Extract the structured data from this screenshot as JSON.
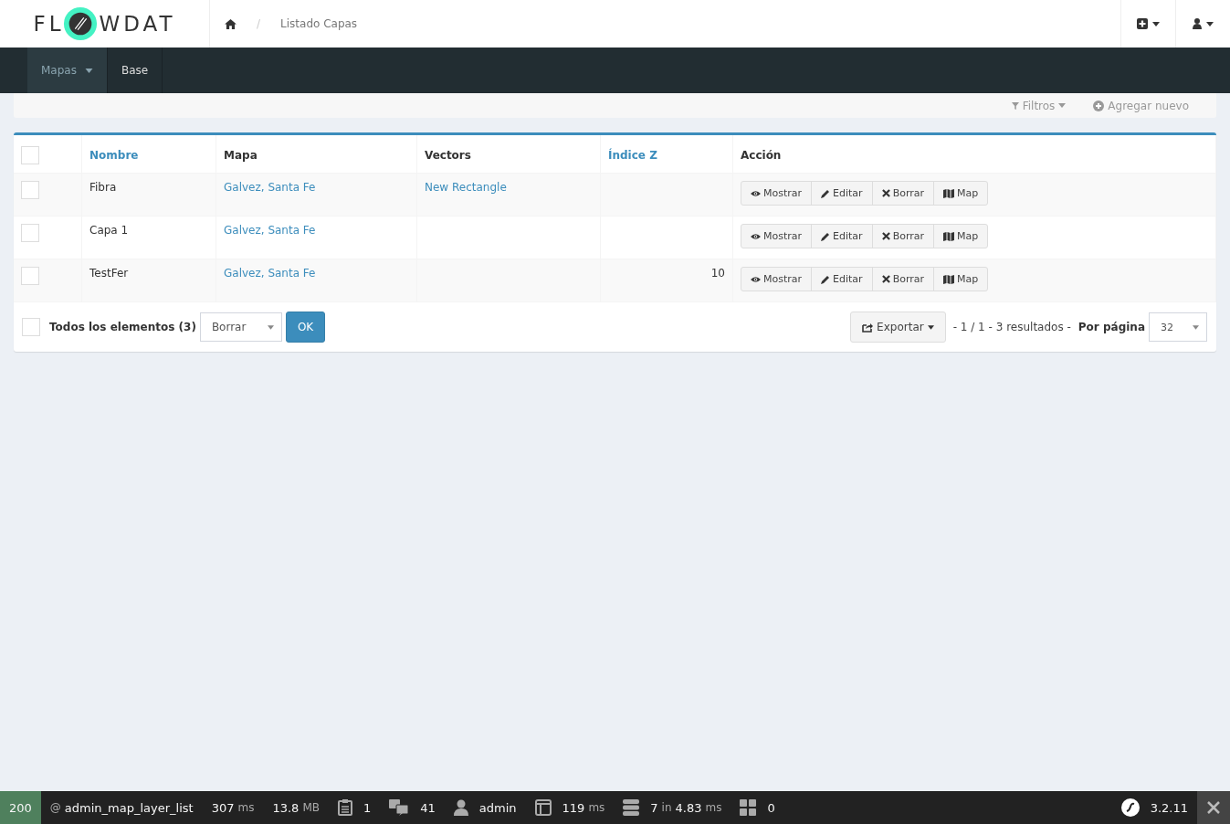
{
  "header": {
    "logo": {
      "left": "FL",
      "right": "WDAT"
    },
    "breadcrumb_separator": "/",
    "breadcrumb": [
      "Listado Capas"
    ]
  },
  "nav": [
    {
      "label": "Mapas",
      "selected": true,
      "dropdown": true
    },
    {
      "label": "Base",
      "selected": false,
      "dropdown": false
    }
  ],
  "actions_bar": [
    {
      "label": "Filtros",
      "dropdown": true
    },
    {
      "label": "Agregar nuevo",
      "dropdown": false
    }
  ],
  "table": {
    "select_all_checked": false,
    "columns": [
      {
        "label": "Nombre",
        "sortable": true
      },
      {
        "label": "Mapa",
        "sortable": false
      },
      {
        "label": "Vectors",
        "sortable": false
      },
      {
        "label": "Índice Z",
        "sortable": true
      },
      {
        "label": "Acción",
        "sortable": false
      }
    ],
    "rows": [
      {
        "checked": false,
        "nombre": "Fibra",
        "mapa": "Galvez, Santa Fe",
        "vectors": "New Rectangle",
        "indice_z": "",
        "actions": [
          "Mostrar",
          "Editar",
          "Borrar",
          "Map"
        ]
      },
      {
        "checked": false,
        "nombre": "Capa 1",
        "mapa": "Galvez, Santa Fe",
        "vectors": "",
        "indice_z": "",
        "actions": [
          "Mostrar",
          "Editar",
          "Borrar",
          "Map"
        ]
      },
      {
        "checked": false,
        "nombre": "TestFer",
        "mapa": "Galvez, Santa Fe",
        "vectors": "",
        "indice_z": "10",
        "actions": [
          "Mostrar",
          "Editar",
          "Borrar",
          "Map"
        ]
      }
    ]
  },
  "footer": {
    "select_all": {
      "checked": false,
      "label": "Todos los elementos (3)"
    },
    "batch_action": "Borrar",
    "ok": "OK",
    "export": "Exportar",
    "pager": "- 1 / 1 - 3 resultados -",
    "per_page_label": "Por página",
    "per_page": "32"
  },
  "debug_toolbar": [
    {
      "kind": "status",
      "text": "200"
    },
    {
      "kind": "route",
      "parts": [
        {
          "t": "@",
          "kind": "unit"
        },
        {
          "t": "admin_map_layer_list",
          "kind": "value"
        }
      ]
    },
    {
      "kind": "plain",
      "parts": [
        {
          "t": "307",
          "kind": "value"
        },
        {
          "t": "ms",
          "kind": "unit"
        }
      ]
    },
    {
      "kind": "plain",
      "parts": [
        {
          "t": "13.8",
          "kind": "value"
        },
        {
          "t": "MB",
          "kind": "unit"
        }
      ]
    },
    {
      "kind": "logs",
      "parts": [
        {
          "t": "1",
          "kind": "value"
        }
      ]
    },
    {
      "kind": "translation",
      "parts": [
        {
          "t": "41",
          "kind": "value"
        }
      ]
    },
    {
      "kind": "user",
      "parts": [
        {
          "t": "admin",
          "kind": "value"
        }
      ]
    },
    {
      "kind": "twig",
      "parts": [
        {
          "t": "119",
          "kind": "value"
        },
        {
          "t": "ms",
          "kind": "unit"
        }
      ]
    },
    {
      "kind": "db",
      "parts": [
        {
          "t": "7",
          "kind": "value"
        },
        {
          "t": "in",
          "kind": "unit"
        },
        {
          "t": "4.83",
          "kind": "value"
        },
        {
          "t": "ms",
          "kind": "unit"
        }
      ]
    },
    {
      "kind": "forms",
      "parts": [
        {
          "t": "0",
          "kind": "value"
        }
      ]
    },
    {
      "kind": "version",
      "parts": [
        {
          "t": "3.2.11",
          "kind": "value"
        }
      ]
    }
  ]
}
